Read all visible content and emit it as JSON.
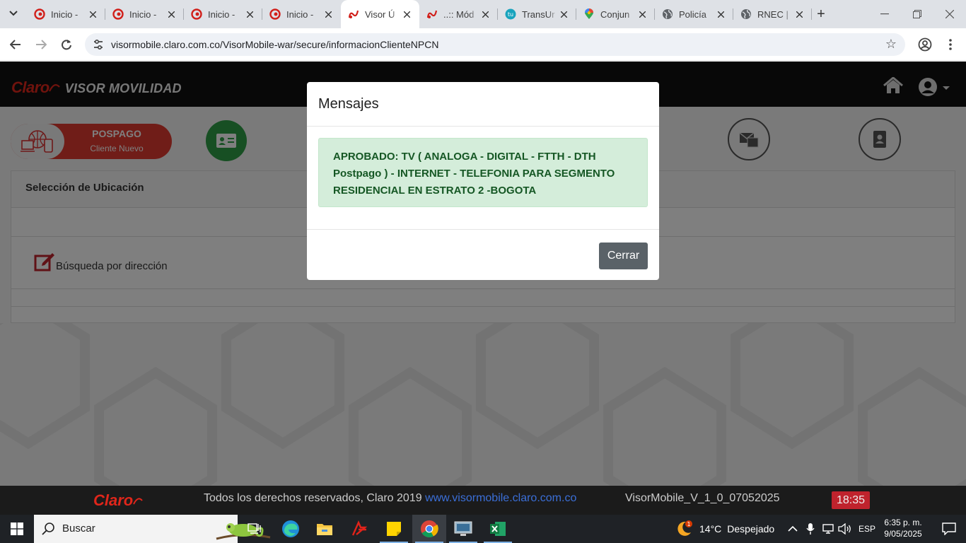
{
  "browser": {
    "tabs": [
      {
        "title": "Inicio - ",
        "favicon": "claro-icon",
        "active": false
      },
      {
        "title": "Inicio - ",
        "favicon": "claro-icon",
        "active": false
      },
      {
        "title": "Inicio - ",
        "favicon": "claro-icon",
        "active": false
      },
      {
        "title": "Inicio - ",
        "favicon": "claro-icon",
        "active": false
      },
      {
        "title": "Visor Ú",
        "favicon": "visor-icon",
        "active": true
      },
      {
        "title": "..:: Mód",
        "favicon": "visor-icon",
        "active": false
      },
      {
        "title": "TransUr",
        "favicon": "transunion-icon",
        "active": false
      },
      {
        "title": "Conjun",
        "favicon": "maps-pin-icon",
        "active": false
      },
      {
        "title": "Policía ",
        "favicon": "globe-icon",
        "active": false
      },
      {
        "title": "RNEC | ",
        "favicon": "globe-icon",
        "active": false
      }
    ],
    "url": "visormobile.claro.com.co/VisorMobile-war/secure/informacionClienteNPCN"
  },
  "app": {
    "brand_claro": "Claro",
    "brand_visor": "VISOR MOVILIDAD",
    "plan": {
      "title": "POSPAGO",
      "subtitle": "Cliente Nuevo"
    },
    "section_title": "Selección de Ubicación",
    "search_label": "Búsqueda por dirección"
  },
  "modal": {
    "title": "Mensajes",
    "message": "APROBADO: TV ( ANALOGA - DIGITAL - FTTH - DTH Postpago ) - INTERNET - TELEFONIA PARA SEGMENTO RESIDENCIAL EN ESTRATO 2 -BOGOTA",
    "close_label": "Cerrar"
  },
  "footer": {
    "logo": "Claro",
    "copyright": "Todos los derechos reservados, Claro 2019 ",
    "link": "www.visormobile.claro.com.co",
    "version": "VisorMobile_V_1_0_07052025",
    "timer": "18:35"
  },
  "taskbar": {
    "search_placeholder": "Buscar",
    "weather_temp": "14°C",
    "weather_desc": "Despejado",
    "weather_badge": "1",
    "language": "ESP",
    "time": "6:35 p. m.",
    "date": "9/05/2025"
  },
  "colors": {
    "claro_red": "#e0261b",
    "alert_bg": "#d4edda",
    "alert_text": "#155724",
    "close_button": "#5a6268"
  }
}
